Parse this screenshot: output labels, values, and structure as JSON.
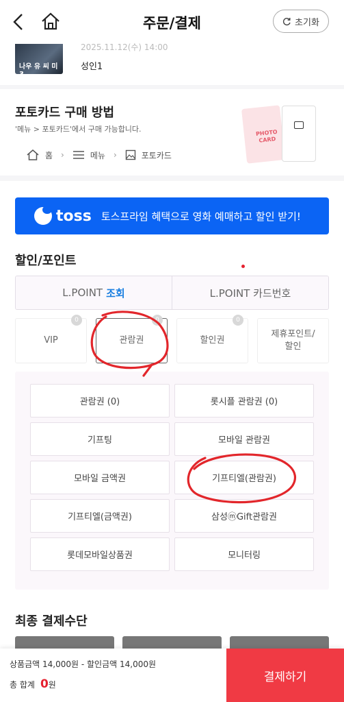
{
  "header": {
    "title": "주문/결제",
    "reset_label": "초기화"
  },
  "movie": {
    "poster_text": "나우 유 씨 미 3",
    "faded_text": "2025.11.12(수) 14:00",
    "seat": "성인1"
  },
  "photocard": {
    "title": "포토카드 구매 방법",
    "desc": "'메뉴 > 포토카드'에서 구매 가능합니다.",
    "breadcrumb": [
      "홈",
      "메뉴",
      "포토카드"
    ],
    "card_text": "PHOTO CARD"
  },
  "toss": {
    "logo": "toss",
    "text": "토스프라임 혜택으로 영화 예매하고 할인 받기!"
  },
  "discount": {
    "title": "할인/포인트",
    "lpoint_tab1_prefix": "L.POINT",
    "lpoint_tab1_link": "조회",
    "lpoint_tab2": "L.POINT 카드번호",
    "types": [
      {
        "label": "VIP",
        "badge": "0"
      },
      {
        "label": "관람권",
        "badge": "0"
      },
      {
        "label": "할인권",
        "badge": "0"
      },
      {
        "label": "제휴포인트/\n할인"
      }
    ],
    "options": [
      "관람권 (0)",
      "롯시플 관람권 (0)",
      "기프팅",
      "모바일 관람권",
      "모바일 금액권",
      "기프티엘(관람권)",
      "기프티엘(금액권)",
      "삼성ⓜGift관람권",
      "롯데모바일상품권",
      "모니터링"
    ]
  },
  "final": {
    "title": "최종 결제수단"
  },
  "bottom": {
    "product_label": "상품금액",
    "product_value": "14,000원",
    "discount_label": "할인금액",
    "discount_value": "14,000원",
    "total_label": "총 합계",
    "total_value": "0",
    "total_unit": "원",
    "pay_label": "결제하기"
  },
  "colors": {
    "accent_red": "#f03a44",
    "toss_blue": "#0b64f4",
    "link_blue": "#1b7fe0"
  }
}
